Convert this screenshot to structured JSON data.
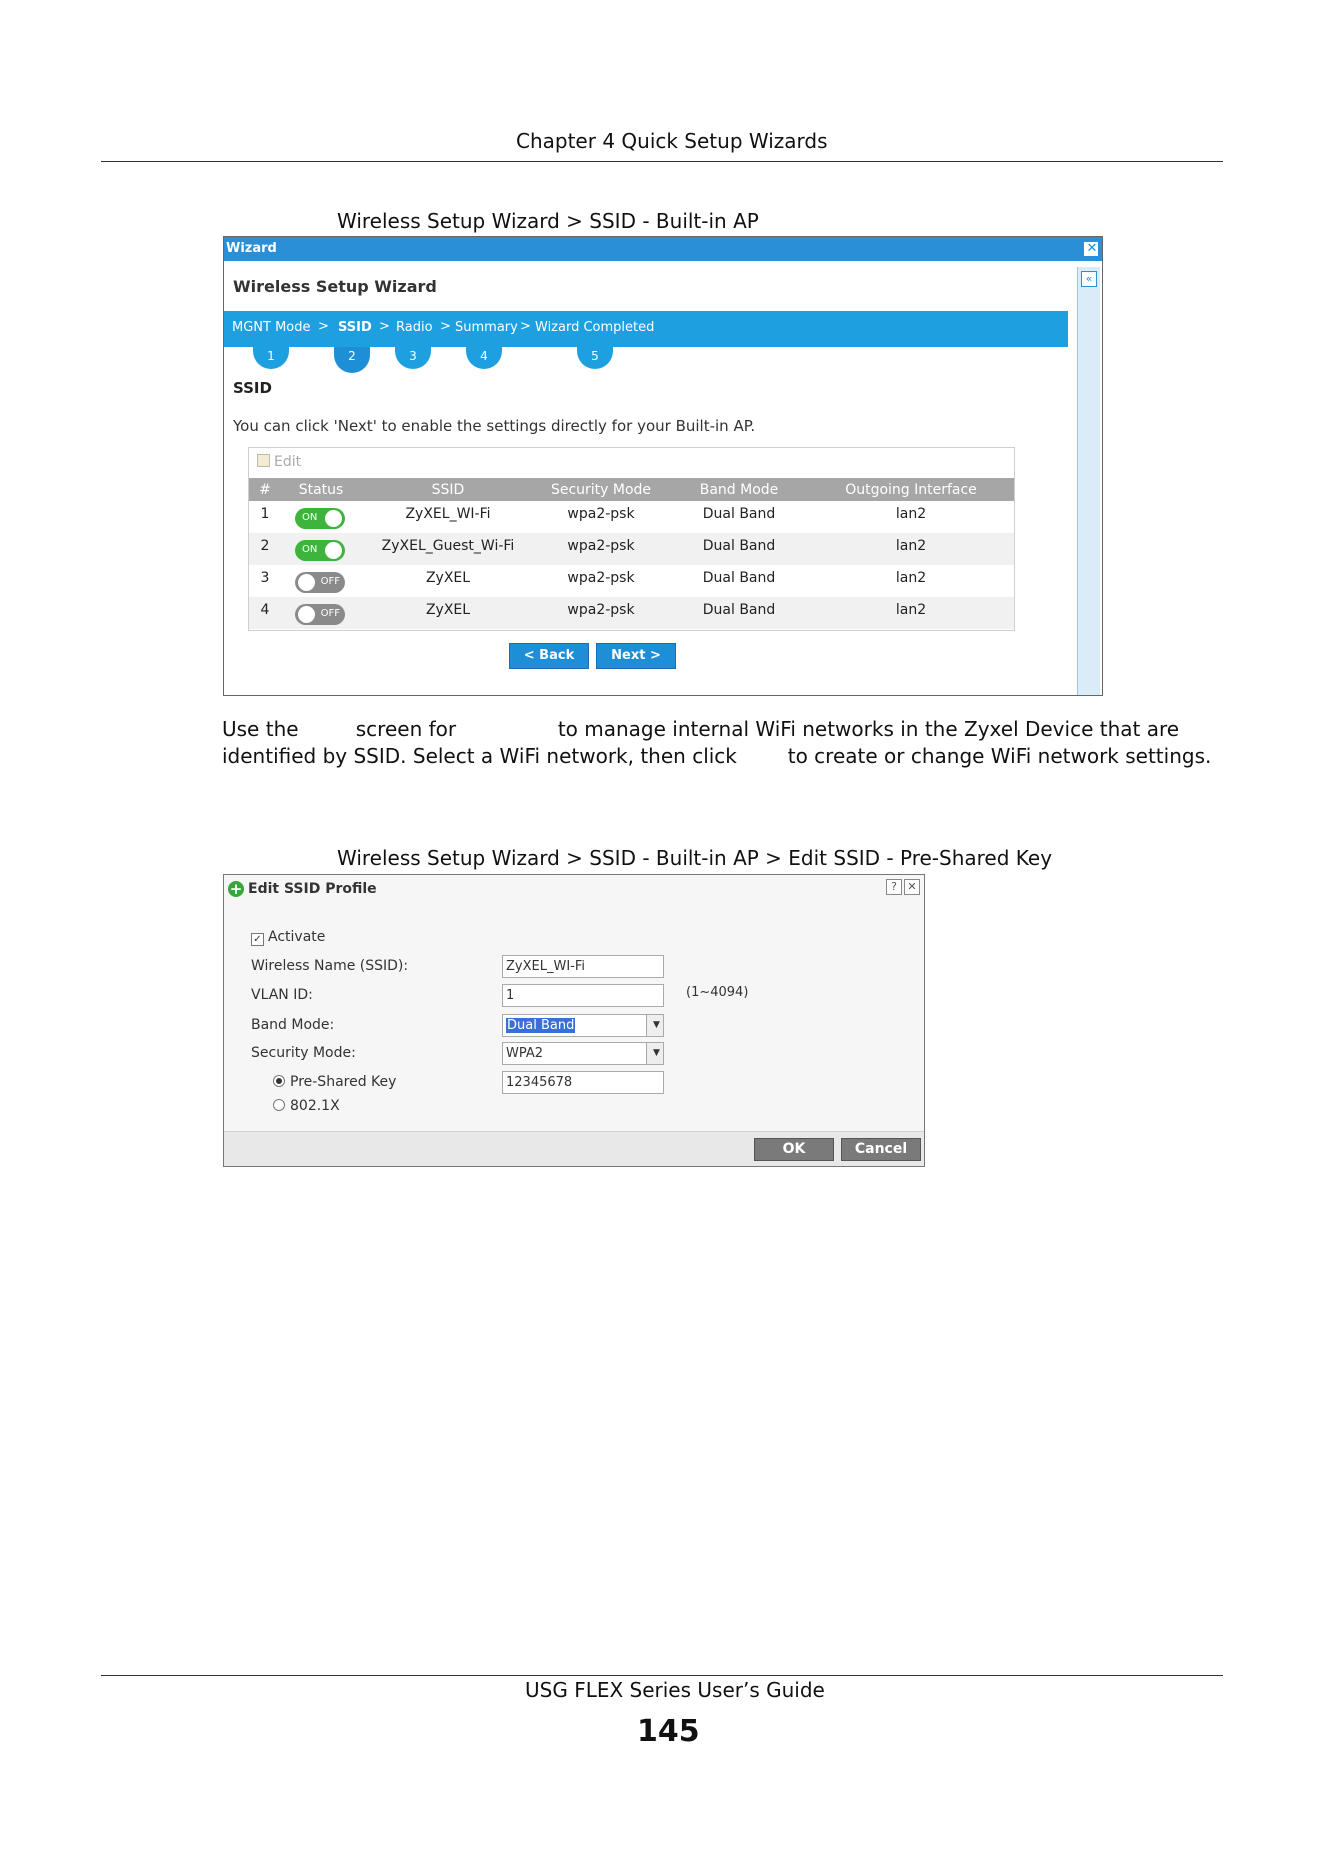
{
  "header": {
    "chapter": "Chapter 4 Quick Setup Wizards"
  },
  "figure1": {
    "caption": "Wireless Setup Wizard > SSID - Built-in AP"
  },
  "wizard": {
    "title": "Wizard",
    "close_icon": "close-icon",
    "heading": "Wireless Setup Wizard",
    "steps": [
      {
        "label": "MGNT Mode",
        "num": "1"
      },
      {
        "label": "SSID",
        "num": "2"
      },
      {
        "label": "Radio",
        "num": "3"
      },
      {
        "label": "Summary",
        "num": "4"
      },
      {
        "label": "Wizard Completed",
        "num": "5"
      }
    ],
    "chevron": ">",
    "section_title": "SSID",
    "info": "You can click 'Next' to enable the settings directly for your Built-in AP.",
    "edit_label": "Edit",
    "columns": [
      "#",
      "Status",
      "SSID",
      "Security Mode",
      "Band Mode",
      "Outgoing Interface"
    ],
    "rows": [
      {
        "num": "1",
        "status": "ON",
        "ssid": "ZyXEL_WI-Fi",
        "security": "wpa2-psk",
        "band": "Dual Band",
        "iface": "lan2"
      },
      {
        "num": "2",
        "status": "ON",
        "ssid": "ZyXEL_Guest_Wi-Fi",
        "security": "wpa2-psk",
        "band": "Dual Band",
        "iface": "lan2"
      },
      {
        "num": "3",
        "status": "OFF",
        "ssid": "ZyXEL",
        "security": "wpa2-psk",
        "band": "Dual Band",
        "iface": "lan2"
      },
      {
        "num": "4",
        "status": "OFF",
        "ssid": "ZyXEL",
        "security": "wpa2-psk",
        "band": "Dual Band",
        "iface": "lan2"
      }
    ],
    "back_label": "< Back",
    "next_label": "Next >",
    "collapse_label": "«"
  },
  "paragraph": {
    "line1": "Use the         screen for                to manage internal WiFi networks in the Zyxel Device that are",
    "line2": "identified by SSID. Select a WiFi network, then click        to create or change WiFi network settings."
  },
  "figure2": {
    "caption": "Wireless Setup Wizard > SSID - Built-in AP > Edit SSID - Pre-Shared Key"
  },
  "edit_dialog": {
    "title": "Edit SSID Profile",
    "help_label": "?",
    "close_label": "✕",
    "activate_label": "Activate",
    "activate_checked": true,
    "ssid_label": "Wireless Name (SSID):",
    "ssid_value": "ZyXEL_WI-Fi",
    "vlan_label": "VLAN ID:",
    "vlan_value": "1",
    "vlan_hint": "(1~4094)",
    "band_label": "Band Mode:",
    "band_value": "Dual Band",
    "security_label": "Security Mode:",
    "security_value": "WPA2",
    "psk_label": "Pre-Shared Key",
    "psk_value": "12345678",
    "dot1x_label": "802.1X",
    "ok_label": "OK",
    "cancel_label": "Cancel"
  },
  "footer": {
    "guide": "USG FLEX Series User’s Guide",
    "page": "145"
  }
}
